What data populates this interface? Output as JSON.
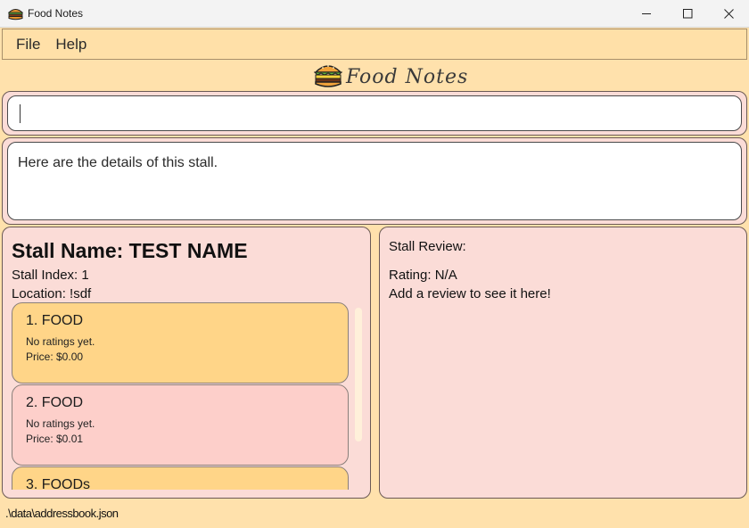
{
  "window": {
    "title": "Food Notes",
    "icon": "burger-icon"
  },
  "menubar": {
    "file": "File",
    "help": "Help"
  },
  "logo": {
    "text": "Food Notes"
  },
  "command": {
    "value": ""
  },
  "result": {
    "text": "Here are the details of this stall."
  },
  "stall": {
    "name": "Stall Name: TEST NAME",
    "index": "Stall Index: 1",
    "location": "Location: !sdf"
  },
  "menu_items": [
    {
      "title": "1.  FOOD",
      "rating": "No ratings yet.",
      "price": "Price: $0.00"
    },
    {
      "title": "2.  FOOD",
      "rating": "No ratings yet.",
      "price": "Price: $0.01"
    },
    {
      "title": "3.  FOODs",
      "rating": "",
      "price": ""
    }
  ],
  "review": {
    "heading": "Stall Review:",
    "rating": "Rating: N/A",
    "text": "Add a review to see it here!"
  },
  "status": {
    "path": ".\\data\\addressbook.json"
  },
  "colors": {
    "background": "#ffe1ac",
    "panel": "#fbdcd7",
    "card_gold": "#ffd588",
    "card_pink": "#fdcfca"
  }
}
